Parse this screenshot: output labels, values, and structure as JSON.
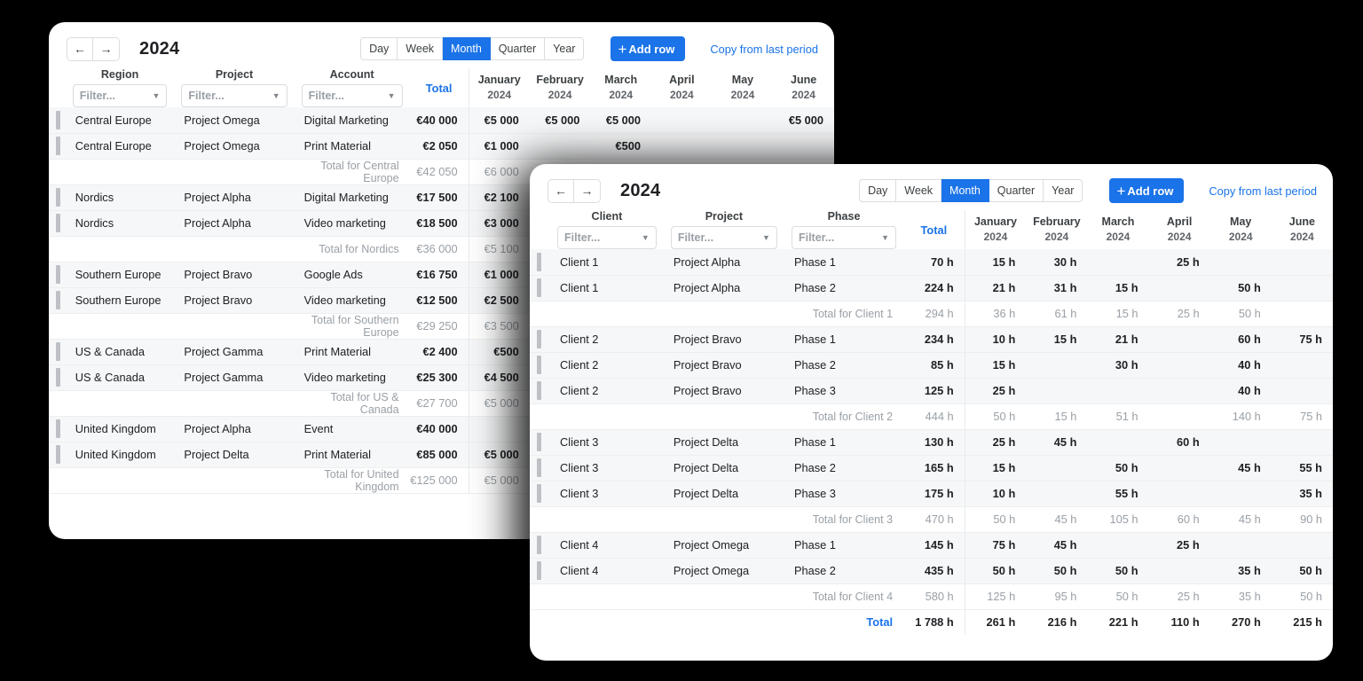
{
  "background_color": "#000000",
  "accent_color": "#1a73e8",
  "toolbar": {
    "prev_icon": "arrow-left-icon",
    "next_icon": "arrow-right-icon",
    "year_title": "2024",
    "ranges": [
      "Day",
      "Week",
      "Month",
      "Quarter",
      "Year"
    ],
    "active_range": "Month",
    "add_row_label": "Add row",
    "add_row_plus": "+",
    "copy_link_label": "Copy from last period"
  },
  "filter_placeholder": "Filter...",
  "months": [
    {
      "name": "January",
      "year": "2024"
    },
    {
      "name": "February",
      "year": "2024"
    },
    {
      "name": "March",
      "year": "2024"
    },
    {
      "name": "April",
      "year": "2024"
    },
    {
      "name": "May",
      "year": "2024"
    },
    {
      "name": "June",
      "year": "2024"
    }
  ],
  "total_header": "Total",
  "budget_table": {
    "columns": [
      "Region",
      "Project",
      "Account"
    ],
    "groups": [
      {
        "subtotal_label": "Total for Central Europe",
        "subtotal_total": "€42 050",
        "subtotal_months": [
          "€6 000",
          "",
          "",
          "",
          "",
          ""
        ],
        "rows": [
          {
            "c": [
              "Central Europe",
              "Project Omega",
              "Digital Marketing"
            ],
            "total": "€40 000",
            "months": [
              "€5 000",
              "€5 000",
              "€5 000",
              "",
              "",
              "€5 000"
            ]
          },
          {
            "c": [
              "Central Europe",
              "Project Omega",
              "Print Material"
            ],
            "total": "€2 050",
            "months": [
              "€1 000",
              "",
              "€500",
              "",
              "",
              ""
            ]
          }
        ]
      },
      {
        "subtotal_label": "Total for Nordics",
        "subtotal_total": "€36 000",
        "subtotal_months": [
          "€5 100",
          "",
          "",
          "",
          "",
          ""
        ],
        "rows": [
          {
            "c": [
              "Nordics",
              "Project Alpha",
              "Digital Marketing"
            ],
            "total": "€17 500",
            "months": [
              "€2 100",
              "",
              "",
              "",
              "",
              ""
            ]
          },
          {
            "c": [
              "Nordics",
              "Project Alpha",
              "Video marketing"
            ],
            "total": "€18 500",
            "months": [
              "€3 000",
              "",
              "",
              "",
              "",
              ""
            ]
          }
        ]
      },
      {
        "subtotal_label": "Total for Southern Europe",
        "subtotal_total": "€29 250",
        "subtotal_months": [
          "€3 500",
          "",
          "",
          "",
          "",
          ""
        ],
        "rows": [
          {
            "c": [
              "Southern Europe",
              "Project Bravo",
              "Google Ads"
            ],
            "total": "€16 750",
            "months": [
              "€1 000",
              "",
              "",
              "",
              "",
              ""
            ]
          },
          {
            "c": [
              "Southern Europe",
              "Project Bravo",
              "Video marketing"
            ],
            "total": "€12 500",
            "months": [
              "€2 500",
              "",
              "",
              "",
              "",
              ""
            ]
          }
        ]
      },
      {
        "subtotal_label": "Total for US & Canada",
        "subtotal_total": "€27 700",
        "subtotal_months": [
          "€5 000",
          "",
          "",
          "",
          "",
          ""
        ],
        "rows": [
          {
            "c": [
              "US & Canada",
              "Project Gamma",
              "Print Material"
            ],
            "total": "€2 400",
            "months": [
              "€500",
              "",
              "",
              "",
              "",
              ""
            ]
          },
          {
            "c": [
              "US & Canada",
              "Project Gamma",
              "Video marketing"
            ],
            "total": "€25 300",
            "months": [
              "€4 500",
              "",
              "",
              "",
              "",
              ""
            ]
          }
        ]
      },
      {
        "subtotal_label": "Total for United Kingdom",
        "subtotal_total": "€125 000",
        "subtotal_months": [
          "€5 000",
          "",
          "",
          "",
          "",
          ""
        ],
        "rows": [
          {
            "c": [
              "United Kingdom",
              "Project Alpha",
              "Event"
            ],
            "total": "€40 000",
            "months": [
              "",
              "",
              "",
              "",
              "",
              ""
            ]
          },
          {
            "c": [
              "United Kingdom",
              "Project Delta",
              "Print Material"
            ],
            "total": "€85 000",
            "months": [
              "€5 000",
              "",
              "",
              "",
              "",
              ""
            ]
          }
        ]
      }
    ]
  },
  "hours_table": {
    "columns": [
      "Client",
      "Project",
      "Phase"
    ],
    "groups": [
      {
        "subtotal_label": "Total for Client 1",
        "subtotal_total": "294 h",
        "subtotal_months": [
          "36 h",
          "61 h",
          "15 h",
          "25 h",
          "50 h",
          ""
        ],
        "rows": [
          {
            "c": [
              "Client 1",
              "Project Alpha",
              "Phase 1"
            ],
            "total": "70 h",
            "months": [
              "15 h",
              "30 h",
              "",
              "25 h",
              "",
              ""
            ]
          },
          {
            "c": [
              "Client 1",
              "Project Alpha",
              "Phase 2"
            ],
            "total": "224 h",
            "months": [
              "21 h",
              "31 h",
              "15 h",
              "",
              "50 h",
              ""
            ]
          }
        ]
      },
      {
        "subtotal_label": "Total for Client 2",
        "subtotal_total": "444 h",
        "subtotal_months": [
          "50 h",
          "15 h",
          "51 h",
          "",
          "140 h",
          "75 h"
        ],
        "rows": [
          {
            "c": [
              "Client 2",
              "Project Bravo",
              "Phase 1"
            ],
            "total": "234 h",
            "months": [
              "10 h",
              "15 h",
              "21 h",
              "",
              "60 h",
              "75 h"
            ]
          },
          {
            "c": [
              "Client 2",
              "Project Bravo",
              "Phase 2"
            ],
            "total": "85 h",
            "months": [
              "15 h",
              "",
              "30 h",
              "",
              "40 h",
              ""
            ]
          },
          {
            "c": [
              "Client 2",
              "Project Bravo",
              "Phase 3"
            ],
            "total": "125 h",
            "months": [
              "25 h",
              "",
              "",
              "",
              "40 h",
              ""
            ]
          }
        ]
      },
      {
        "subtotal_label": "Total for Client 3",
        "subtotal_total": "470 h",
        "subtotal_months": [
          "50 h",
          "45 h",
          "105 h",
          "60 h",
          "45 h",
          "90 h"
        ],
        "rows": [
          {
            "c": [
              "Client 3",
              "Project Delta",
              "Phase 1"
            ],
            "total": "130 h",
            "months": [
              "25 h",
              "45 h",
              "",
              "60 h",
              "",
              ""
            ]
          },
          {
            "c": [
              "Client 3",
              "Project Delta",
              "Phase 2"
            ],
            "total": "165 h",
            "months": [
              "15 h",
              "",
              "50 h",
              "",
              "45 h",
              "55 h"
            ]
          },
          {
            "c": [
              "Client 3",
              "Project Delta",
              "Phase 3"
            ],
            "total": "175 h",
            "months": [
              "10 h",
              "",
              "55 h",
              "",
              "",
              "35 h"
            ]
          }
        ]
      },
      {
        "subtotal_label": "Total for Client 4",
        "subtotal_total": "580 h",
        "subtotal_months": [
          "125 h",
          "95 h",
          "50 h",
          "25 h",
          "35 h",
          "50 h"
        ],
        "rows": [
          {
            "c": [
              "Client 4",
              "Project Omega",
              "Phase 1"
            ],
            "total": "145 h",
            "months": [
              "75 h",
              "45 h",
              "",
              "25 h",
              "",
              ""
            ]
          },
          {
            "c": [
              "Client 4",
              "Project Omega",
              "Phase 2"
            ],
            "total": "435 h",
            "months": [
              "50 h",
              "50 h",
              "50 h",
              "",
              "35 h",
              "50 h"
            ]
          }
        ]
      }
    ],
    "grand": {
      "label": "Total",
      "total": "1 788 h",
      "months": [
        "261 h",
        "216 h",
        "221 h",
        "110 h",
        "270 h",
        "215 h"
      ]
    }
  }
}
